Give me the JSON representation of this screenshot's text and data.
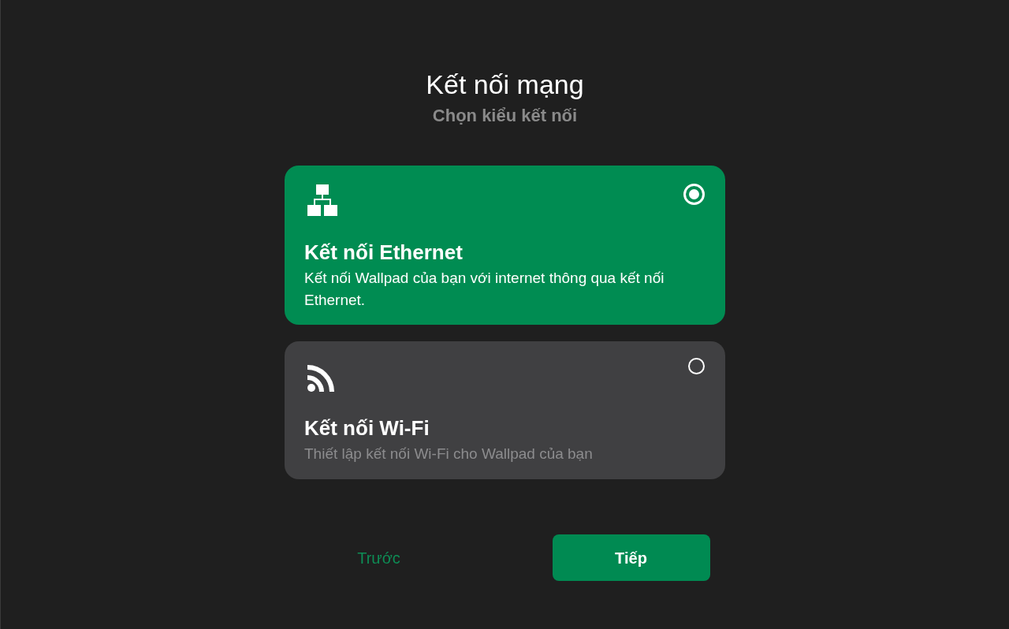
{
  "title": "Kết nối mạng",
  "subtitle": "Chọn kiểu kết nối",
  "options": [
    {
      "kind": "ethernet",
      "title": "Kết nối Ethernet",
      "description": "Kết nối Wallpad của bạn với internet thông qua kết nối Ethernet.",
      "selected": true
    },
    {
      "kind": "wifi",
      "title": "Kết nối Wi-Fi",
      "description": "Thiết lập kết nối Wi-Fi cho Wallpad của bạn",
      "selected": false
    }
  ],
  "buttons": [
    {
      "kind": "back",
      "label": "Trước"
    },
    {
      "kind": "next",
      "label": "Tiếp"
    }
  ]
}
